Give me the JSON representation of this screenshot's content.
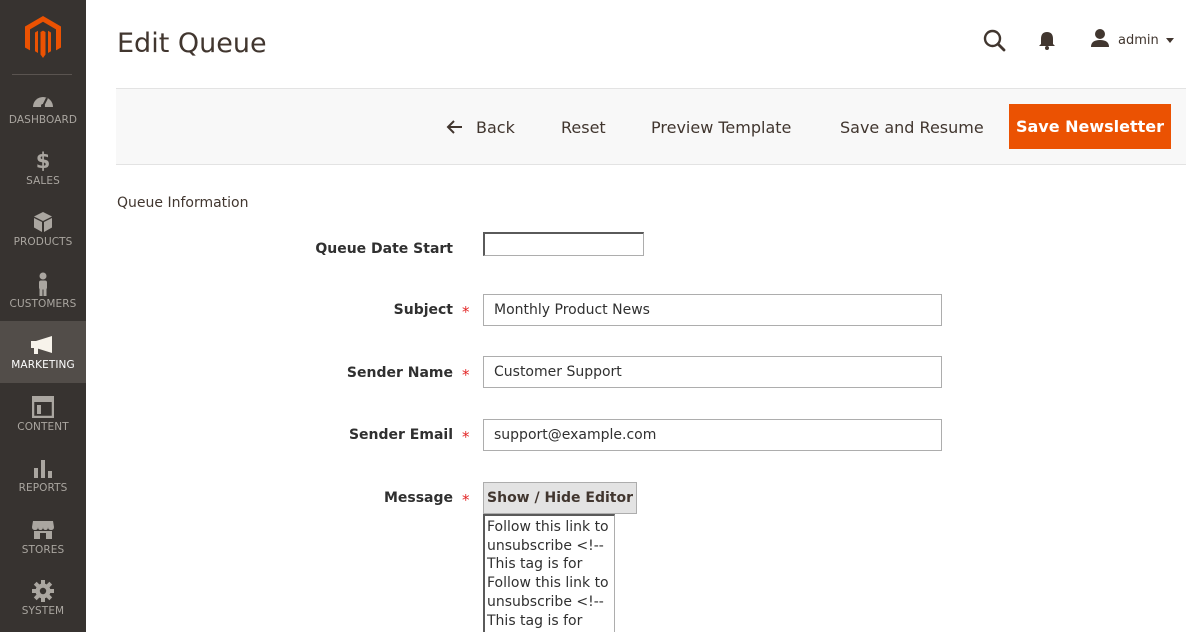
{
  "sidebar": {
    "logo_icon": "magento-logo-icon",
    "items": [
      {
        "label": "DASHBOARD",
        "icon": "dashboard-gauge-icon"
      },
      {
        "label": "SALES",
        "icon": "dollar-icon"
      },
      {
        "label": "PRODUCTS",
        "icon": "cube-icon"
      },
      {
        "label": "CUSTOMERS",
        "icon": "person-icon"
      },
      {
        "label": "MARKETING",
        "icon": "megaphone-icon",
        "active": true
      },
      {
        "label": "CONTENT",
        "icon": "layout-icon"
      },
      {
        "label": "REPORTS",
        "icon": "bar-chart-icon"
      },
      {
        "label": "STORES",
        "icon": "storefront-icon"
      },
      {
        "label": "SYSTEM",
        "icon": "gear-icon"
      }
    ]
  },
  "header": {
    "title": "Edit Queue",
    "user_name": "admin"
  },
  "actions": {
    "back": "Back",
    "reset": "Reset",
    "preview": "Preview Template",
    "save_resume": "Save and Resume",
    "save_newsletter": "Save Newsletter"
  },
  "form": {
    "section_title": "Queue Information",
    "queue_date_label": "Queue Date Start",
    "queue_date_value": "",
    "subject_label": "Subject",
    "subject_value": "Monthly Product News",
    "sender_name_label": "Sender Name",
    "sender_name_value": "Customer Support",
    "sender_email_label": "Sender Email",
    "sender_email_value": "support@example.com",
    "message_label": "Message",
    "required_mark": "*",
    "editor_toggle": "Show / Hide Editor",
    "message_value": "Follow this link to unsubscribe <!-- This tag is for\nFollow this link to unsubscribe <!-- This tag is for"
  },
  "colors": {
    "sidebar_bg": "#373330",
    "sidebar_active": "#524d49",
    "accent": "#eb5202",
    "required": "#e22626"
  }
}
